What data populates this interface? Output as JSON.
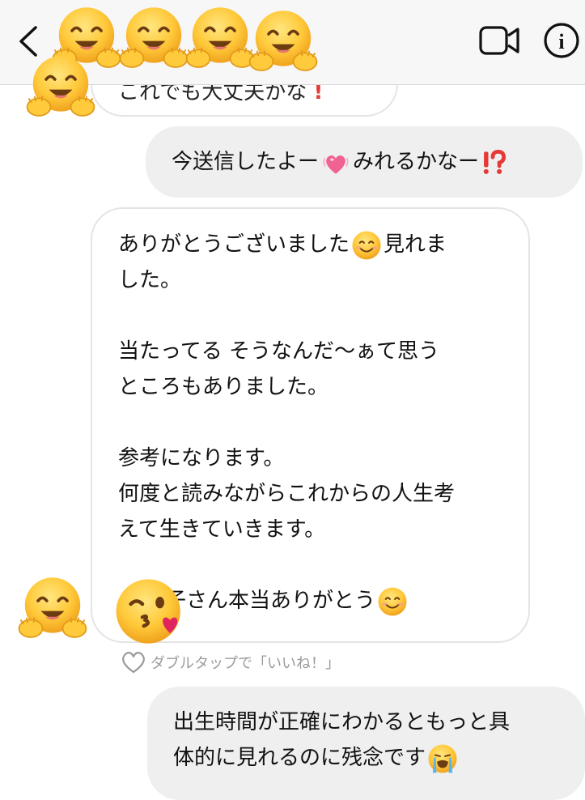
{
  "header": {
    "back_icon": "chevron-left-icon",
    "video_icon": "video-camera-icon",
    "info_icon": "info-icon",
    "info_glyph": "i"
  },
  "messages": {
    "top_partial": "これでも大丈夫かな",
    "sent_1": {
      "text_a": "今送信したよー",
      "text_b": "みれるかなー",
      "emojis": [
        "growing-heart-emoji",
        "exclamation-question-emoji"
      ]
    },
    "received": {
      "line1_a": "ありがとうございました",
      "line1_b": "見れま",
      "line2": "した。",
      "line3": "当たってる そうなんだ〜ぁて思う",
      "line4": "ところもありました。",
      "line5": "参考になります。",
      "line6": "何度と読みながらこれからの人生考",
      "line7": "えて生きていきます。",
      "line8": "子さん本当ありがとう",
      "emojis": [
        "smiling-face-emoji",
        "smiling-face-emoji"
      ]
    },
    "sent_2": {
      "line1": "出生時間が正確にわかるともっと具",
      "line2": "体的に見れるのに残念です",
      "emoji": "loudly-crying-face-emoji"
    }
  },
  "like_hint": {
    "label": "ダブルタップで「いいね！」",
    "icon": "heart-outline-icon"
  },
  "stickers": [
    "hugging-face-emoji",
    "face-blowing-kiss-emoji"
  ],
  "colors": {
    "header_bg": "#f7f7f7",
    "received_border": "#e4e4e4",
    "sent_bg": "#efefef",
    "emoji_yellow": "#fbc02d",
    "heart_pink": "#f06292",
    "exclaim_red": "#e53935"
  }
}
